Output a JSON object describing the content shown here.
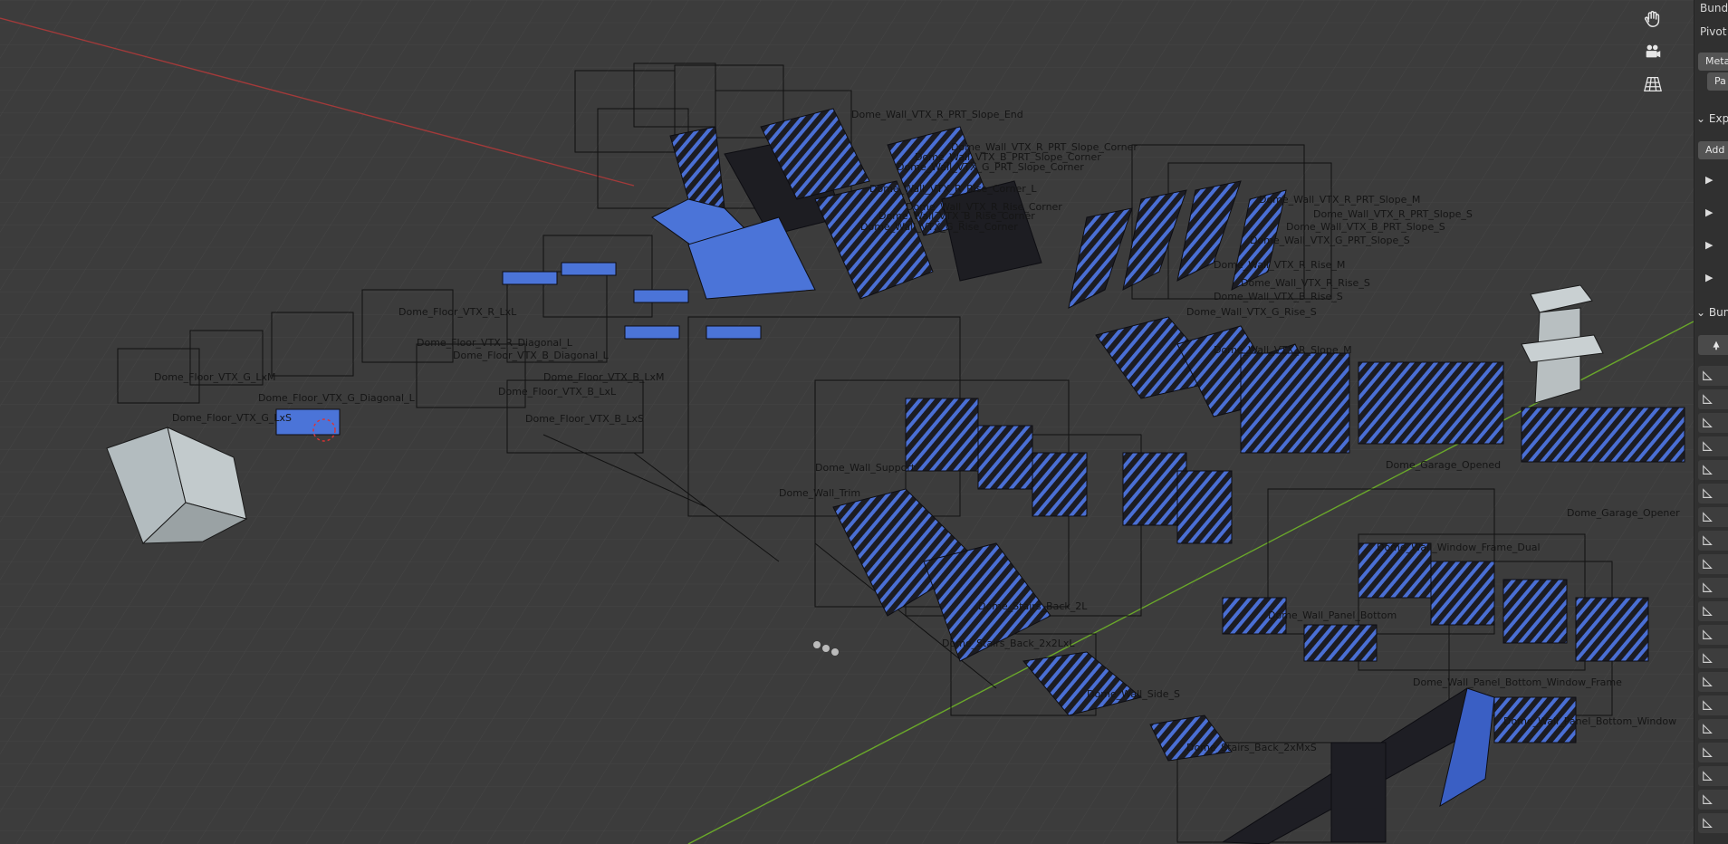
{
  "viewport": {
    "labels": [
      "Dome_Wall_VTX_R_PRT_Slope_End",
      "Dome_Wall_VTX_R_PRT_Slope_Corner",
      "Dome_Wall_VTX_B_PRT_Slope_Corner",
      "Dome_Wall_VTX_G_PRT_Slope_Corner",
      "Dome_Wall_VTX_R_Rise_Corner_L",
      "Dome_Wall_VTX_R_Rise_Corner",
      "Dome_Wall_VTX_B_Rise_Corner",
      "Dome_Wall_VTX_G_Rise_Corner",
      "Dome_Wall_VTX_R_PRT_Slope_M",
      "Dome_Wall_VTX_R_PRT_Slope_S",
      "Dome_Wall_VTX_B_PRT_Slope_S",
      "Dome_Wall_VTX_G_PRT_Slope_S",
      "Dome_Wall_VTX_R_Rise_M",
      "Dome_Wall_VTX_R_Rise_S",
      "Dome_Wall_VTX_B_Rise_S",
      "Dome_Wall_VTX_G_Rise_S",
      "Dome_Wall_VTX_R_Slope_M",
      "Dome_Floor_VTX_R_LxL",
      "Dome_Floor_VTX_B_LxL",
      "Dome_Floor_VTX_R_Diagonal_L",
      "Dome_Floor_VTX_B_Diagonal_L",
      "Dome_Floor_VTX_G_Diagonal_L",
      "Dome_Floor_VTX_G_LxM",
      "Dome_Floor_VTX_G_LxS",
      "Dome_Floor_VTX_B_LxS",
      "Dome_Floor_VTX_B_LxM",
      "Dome_Garage_Opener",
      "Dome_Garage_Opened",
      "Dome_Wall_Panel_Bottom_Window_Frame",
      "Dome_Wall_Panel_Bottom_Window",
      "Dome_Wall_Window_Frame_Dual",
      "Dome_Wall_Side_S",
      "Dome_Stairs_Back_2xMxS",
      "Dome_Stairs_Back_2x2LxL",
      "Dome_Stairs_Back_2L",
      "Dome_Wall_Panel_Bottom",
      "Dome_Wall_Trim",
      "Dome_Wall_Support"
    ]
  },
  "npanel": {
    "row1": "Bundle",
    "row2": "Pivot",
    "btn1": "Meta",
    "btn2": "Pa",
    "section1": "Exp",
    "add_btn": "Add",
    "sub1": "",
    "section2": "Bun"
  }
}
